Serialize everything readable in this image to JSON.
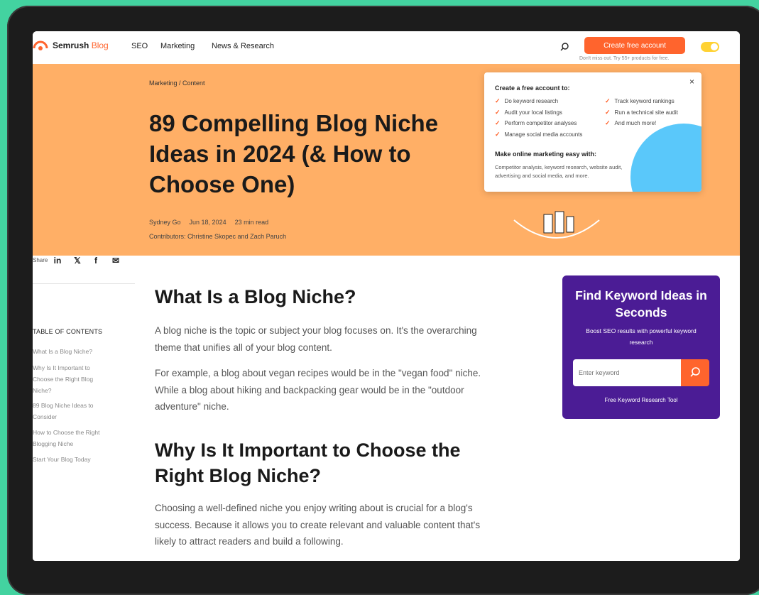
{
  "nav": {
    "logo_main": "Semrush",
    "logo_sub": "Blog",
    "links": [
      "SEO",
      "Marketing",
      "News & Research"
    ],
    "cta_label": "Create free account",
    "cta_note": "Don't miss out. Try 55+ products for free."
  },
  "hero": {
    "breadcrumb": "Marketing / Content",
    "title": "89 Compelling Blog Niche Ideas in 2024 (& How to Choose One)",
    "author": "Sydney Go",
    "date": "Jun 18, 2024",
    "read_time": "23 min read",
    "contributors": "Contributors: Christine Skopec and Zach Paruch"
  },
  "popup": {
    "heading": "Create a free account to:",
    "left_items": [
      "Do keyword research",
      "Audit your local listings",
      "Perform competitor analyses",
      "Manage social media accounts"
    ],
    "right_items": [
      "Track keyword rankings",
      "Run a technical site audit",
      "And much more!"
    ],
    "heading2": "Make online marketing easy with:",
    "desc": "Competitor analysis, keyword research, website audit, advertising and social media, and more.",
    "close": "×"
  },
  "sidebar": {
    "share_label": "Share",
    "share_icons": [
      "in",
      "𝕏",
      "f",
      "✉"
    ],
    "toc_heading": "TABLE OF CONTENTS",
    "toc_items": [
      "What Is a Blog Niche?",
      "Why Is It Important to Choose the Right Blog Niche?",
      "89 Blog Niche Ideas to Consider",
      "How to Choose the Right Blogging Niche",
      "Start Your Blog Today"
    ]
  },
  "article": {
    "h1": "What Is a Blog Niche?",
    "p1": "A blog niche is the topic or subject your blog focuses on. It's the overarching theme that unifies all of your blog content.",
    "p2": "For example, a blog about vegan recipes would be in the \"vegan food\" niche. While a blog about hiking and backpacking gear would be in the \"outdoor adventure\" niche.",
    "h2": "Why Is It Important to Choose the Right Blog Niche?",
    "p3": "Choosing a well-defined niche you enjoy writing about is crucial for a blog's success. Because it allows you to create relevant and valuable content that's likely to attract readers and build a following."
  },
  "keyword_widget": {
    "title": "Find Keyword Ideas in Seconds",
    "subtitle": "Boost SEO results with powerful keyword research",
    "input_placeholder": "Enter keyword",
    "link": "Free Keyword Research Tool"
  },
  "colors": {
    "accent": "#ff642d",
    "hero_bg": "#ffaf66",
    "widget_bg": "#4b1c95",
    "frame_bg": "#43d3a0"
  }
}
